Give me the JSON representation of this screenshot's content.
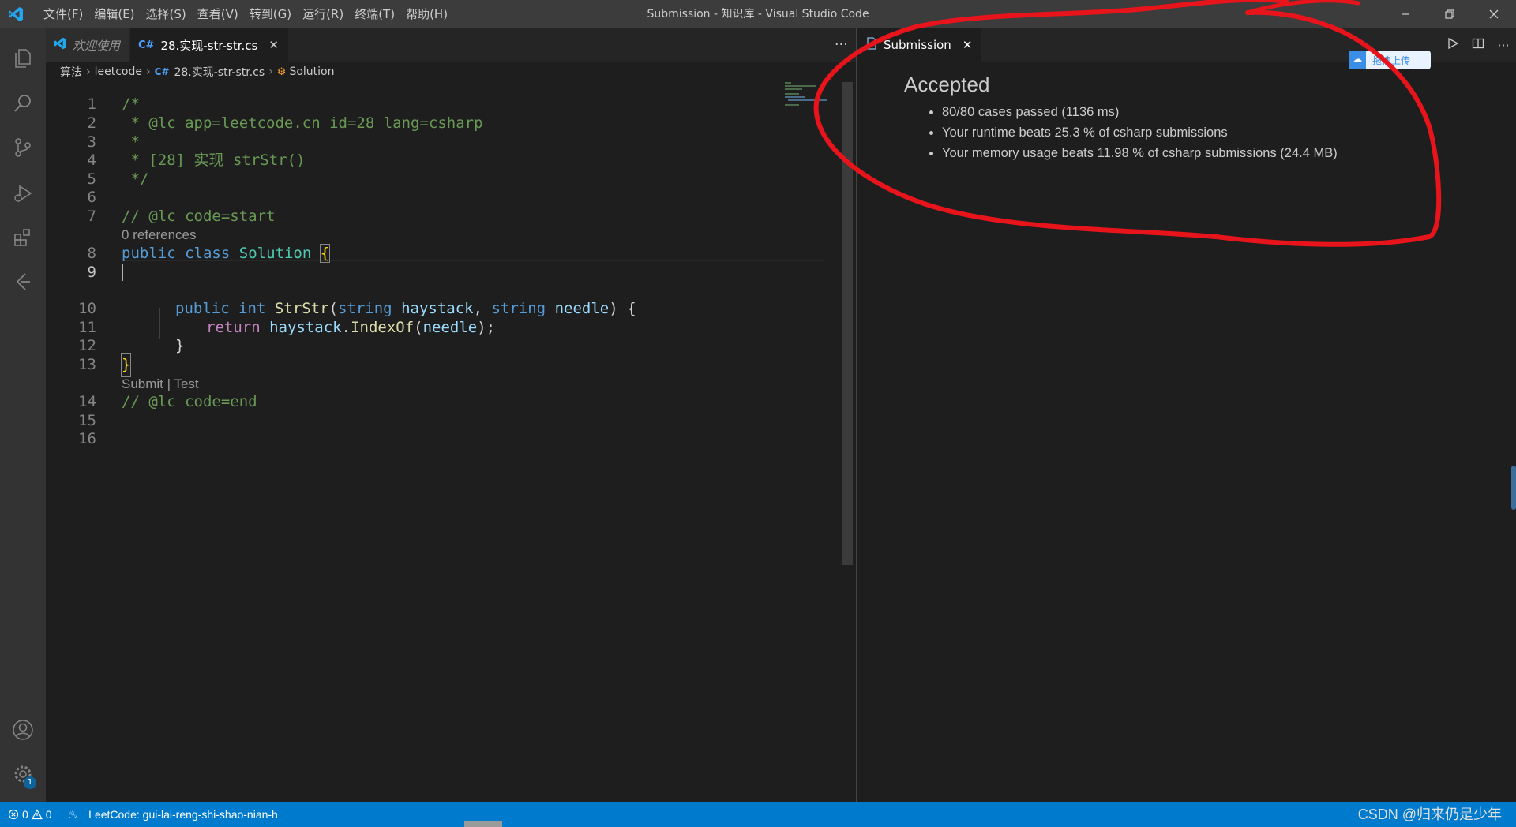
{
  "window": {
    "title": "Submission - 知识库 - Visual Studio Code",
    "menu": [
      "文件(F)",
      "编辑(E)",
      "选择(S)",
      "查看(V)",
      "转到(G)",
      "运行(R)",
      "终端(T)",
      "帮助(H)"
    ]
  },
  "activity_bar": {
    "icons": [
      "files-icon",
      "search-icon",
      "source-control-icon",
      "run-debug-icon",
      "extensions-icon",
      "leetcode-icon",
      "account-icon",
      "settings-gear-icon"
    ],
    "settings_badge": "1"
  },
  "left_editor": {
    "tabs": [
      {
        "label": "欢迎使用",
        "icon": "vscode-icon",
        "active": false
      },
      {
        "label": "28.实现-str-str.cs",
        "icon": "C#",
        "active": true
      }
    ],
    "more": "···",
    "breadcrumb": {
      "folder1": "算法",
      "folder2": "leetcode",
      "file_icon": "C#",
      "file": "28.实现-str-str.cs",
      "symbol": "Solution"
    },
    "codelens_refs": "0 references",
    "codelens_submit": "Submit | Test",
    "line_numbers": [
      "1",
      "2",
      "3",
      "4",
      "5",
      "6",
      "7",
      "8",
      "9",
      "10",
      "11",
      "12",
      "13",
      "14",
      "15",
      "16"
    ],
    "code": {
      "l1": "/*",
      "l2": " * @lc app=leetcode.cn id=28 lang=csharp",
      "l3": " *",
      "l4": " * [28] 实现 strStr()",
      "l5": " */",
      "l7": "// @lc code=start",
      "l8_kw1": "public",
      "l8_kw2": "class",
      "l8_type": "Solution",
      "l8_brace": "{",
      "l10_kw1": "public",
      "l10_kw2": "int",
      "l10_fn": "StrStr",
      "l10_p1": "(",
      "l10_t1": "string",
      "l10_v1": "haystack",
      "l10_comma": ",",
      "l10_t2": "string",
      "l10_v2": "needle",
      "l10_p2": ") {",
      "l11_kw": "return",
      "l11_v1": "haystack",
      "l11_dot": ".",
      "l11_fn": "IndexOf",
      "l11_p1": "(",
      "l11_v2": "needle",
      "l11_p2": ");",
      "l12": "}",
      "l13": "}",
      "l14": "// @lc code=end"
    }
  },
  "right_editor": {
    "tab_label": "Submission",
    "actions": [
      "run-icon",
      "split-editor-icon",
      "more-icon"
    ],
    "upload_button": "拖拽上传",
    "result_title": "Accepted",
    "result_items": [
      "80/80 cases passed (1136 ms)",
      "Your runtime beats 25.3 % of csharp submissions",
      "Your memory usage beats 11.98 % of csharp submissions (24.4 MB)"
    ]
  },
  "status_bar": {
    "errors": "0",
    "warnings": "0",
    "leetcode_user": "LeetCode: gui-lai-reng-shi-shao-nian-h",
    "watermark": "CSDN @归来仍是少年"
  },
  "colors": {
    "accent": "#007acc",
    "annotation": "#e8141c",
    "comment": "#6a9955",
    "keyword": "#569cd6"
  }
}
